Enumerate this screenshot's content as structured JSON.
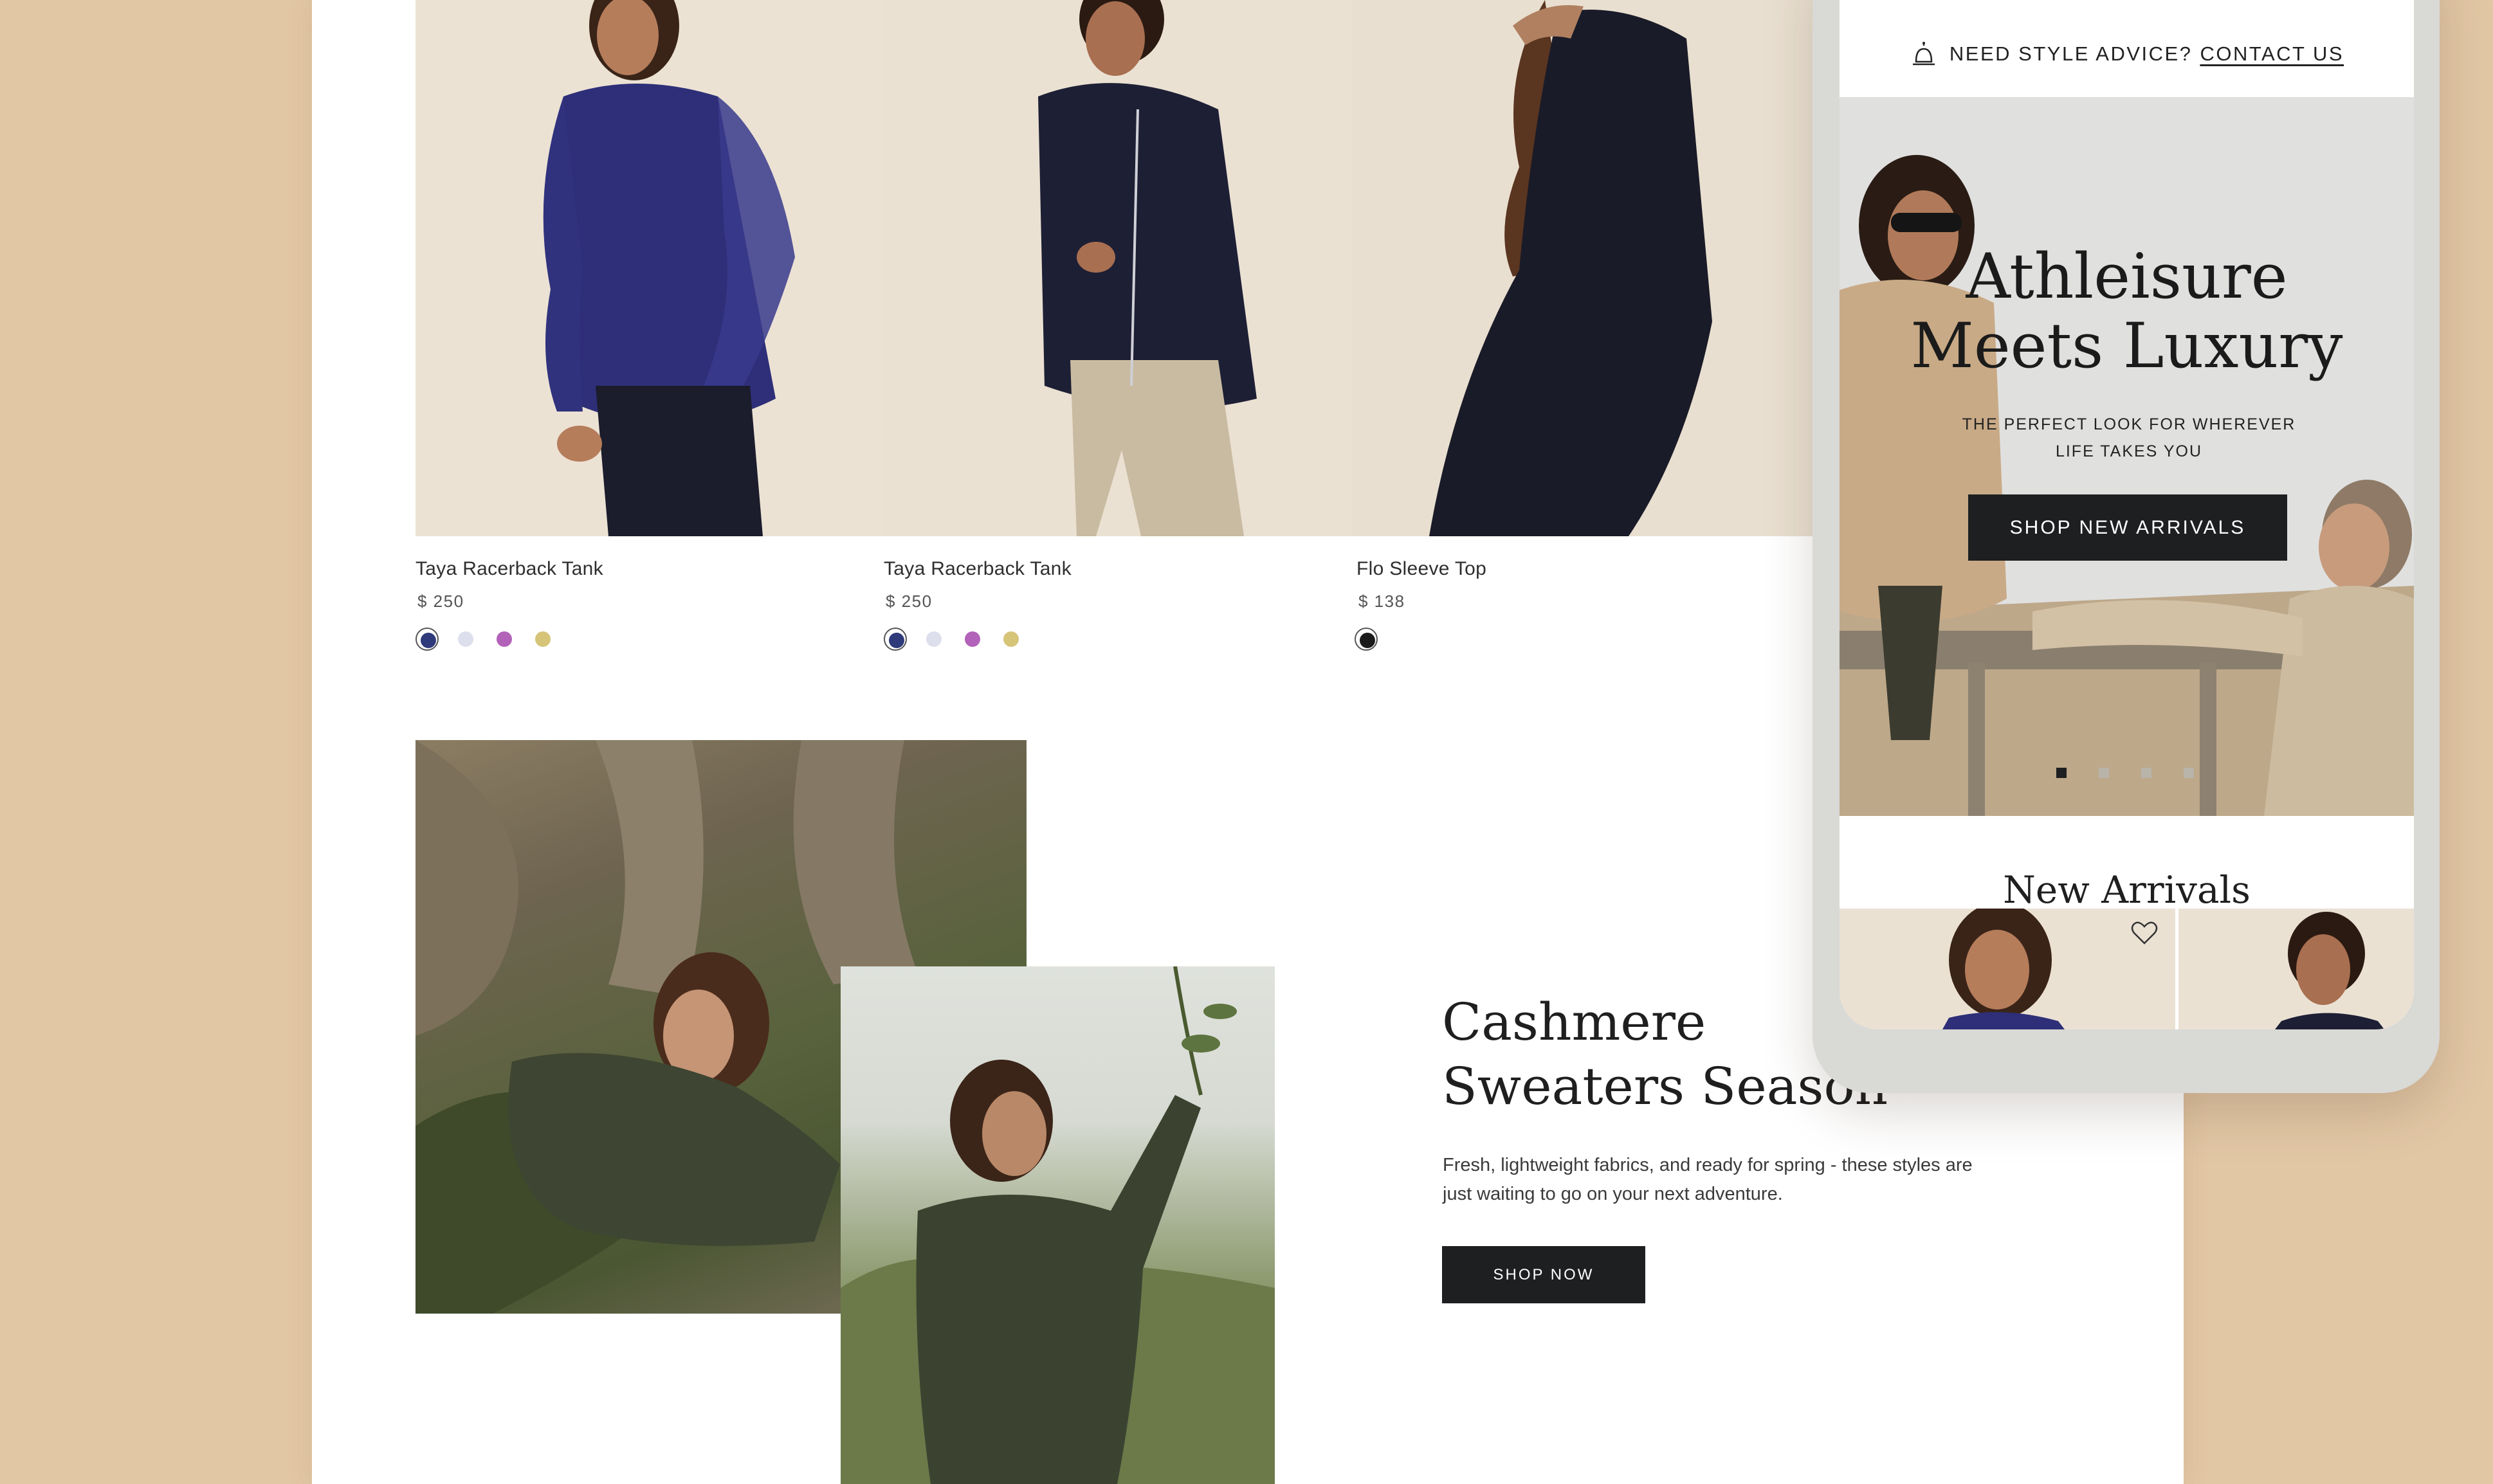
{
  "products": [
    {
      "name": "Taya Racerback Tank",
      "price": "$ 250",
      "swatches": [
        "#2e3a7a",
        "#dde0ec",
        "#b262b8",
        "#d6c478"
      ],
      "selected": 0
    },
    {
      "name": "Taya Racerback Tank",
      "price": "$ 250",
      "swatches": [
        "#2e3a7a",
        "#dde0ec",
        "#b262b8",
        "#d6c478"
      ],
      "selected": 0
    },
    {
      "name": "Flo Sleeve Top",
      "price": "$ 138",
      "swatches": [
        "#1b1b1b"
      ],
      "selected": 0
    }
  ],
  "feature": {
    "title_line1": "Cashmere",
    "title_line2": "Sweaters Season",
    "description": "Fresh, lightweight fabrics, and ready for spring - these styles are just waiting to go on your next adventure.",
    "button": "SHOP NOW"
  },
  "mobile": {
    "advice_text": "NEED STYLE ADVICE?",
    "advice_link": "CONTACT US",
    "hero_title_line1": "Athleisure",
    "hero_title_line2": "Meets Luxury",
    "hero_subtitle": "THE PERFECT LOOK FOR WHEREVER LIFE TAKES YOU",
    "hero_button": "SHOP NEW ARRIVALS",
    "slides_count": 4,
    "active_slide": 0,
    "section_title": "New Arrivals"
  },
  "colors": {
    "background": "#e2c7a5",
    "button": "#1d1f20",
    "page": "#ffffff"
  },
  "icons": [
    "hand-cursor-icon",
    "bell-icon",
    "heart-icon"
  ]
}
